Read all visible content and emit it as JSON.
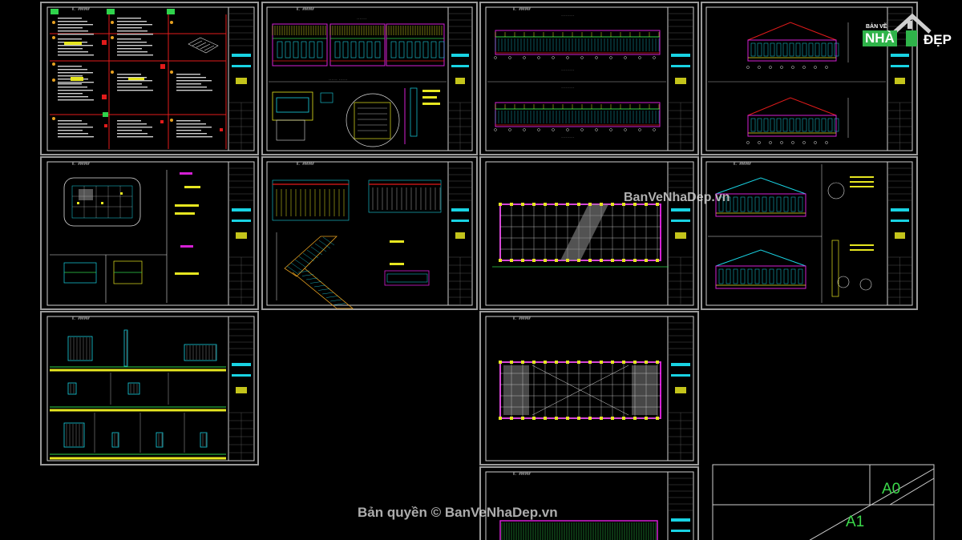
{
  "viewer": {
    "sheet_header_label": "K. ######",
    "copyright_text": "Bản quyền © BanVeNhaDep.vn",
    "watermark_text": "BanVeNhaDep.vn",
    "logo": {
      "small_text": "BẢN VẼ",
      "brand_left": "NHÀ",
      "brand_right": "ĐẸP"
    },
    "paper_size_labels": [
      "A0",
      "A1"
    ]
  },
  "colors": {
    "background": "#000000",
    "sheet_border": "#9a9a9a",
    "magenta": "#d520d5",
    "cyan": "#19d3e3",
    "yellow": "#e6e620",
    "green": "#3bd84a",
    "red": "#e21b1b",
    "logo_green": "#2fb34a"
  },
  "sheets": [
    {
      "id": "s01",
      "icon": "details-sheet"
    },
    {
      "id": "s02",
      "icon": "elevation-sheet"
    },
    {
      "id": "s03",
      "icon": "long-elevation-sheet"
    },
    {
      "id": "s04",
      "icon": "section-sheet"
    },
    {
      "id": "s05",
      "icon": "plan-detail-sheet"
    },
    {
      "id": "s06",
      "icon": "stair-sheet"
    },
    {
      "id": "s07",
      "icon": "floor-plan-sheet"
    },
    {
      "id": "s08",
      "icon": "roof-section-sheet"
    },
    {
      "id": "s09",
      "icon": "door-window-sheet"
    },
    {
      "id": "s10",
      "icon": "roof-plan-sheet"
    },
    {
      "id": "s11",
      "icon": "foundation-plan-sheet"
    }
  ]
}
